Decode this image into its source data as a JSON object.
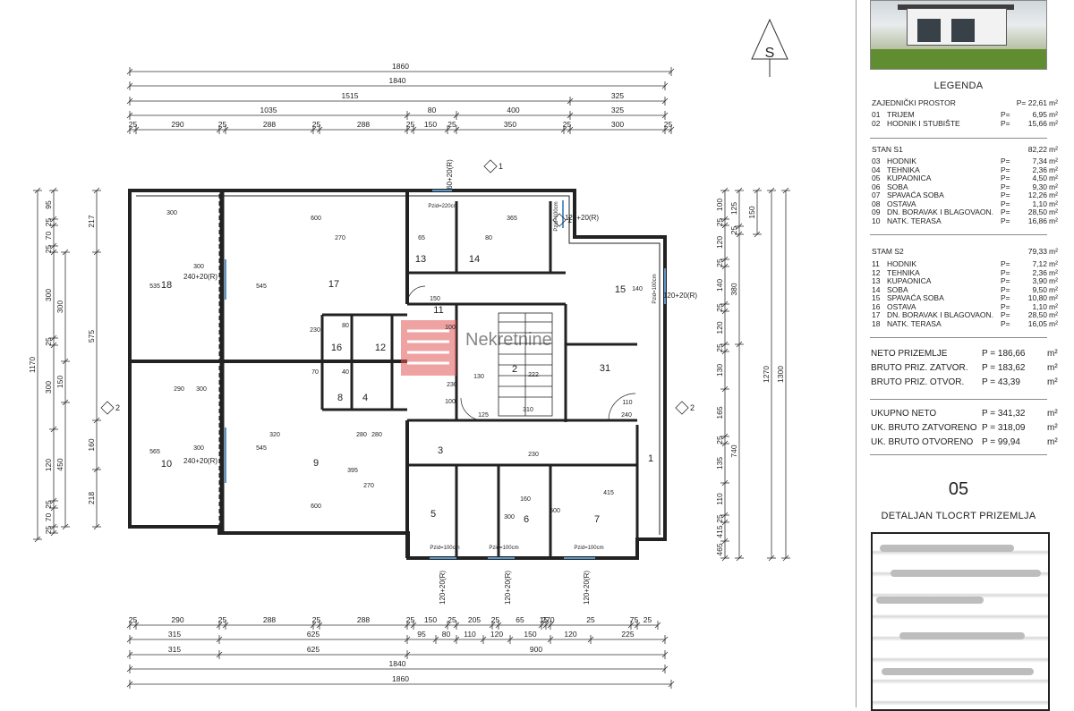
{
  "plan": {
    "north_label": "S",
    "top_dims": {
      "overall": "1860",
      "row2": "1840",
      "row3": [
        "1515",
        "325"
      ],
      "row4": [
        "1035",
        "80",
        "400",
        "325"
      ],
      "row5": [
        "25",
        "290",
        "25",
        "288",
        "25",
        "288",
        "25",
        "150",
        "25",
        "350",
        "25",
        "300",
        "25"
      ]
    },
    "bottom_dims": {
      "row1": [
        "25",
        "290",
        "25",
        "288",
        "25",
        "288",
        "25",
        "150",
        "25",
        "205",
        "25",
        "65",
        "15",
        "270",
        "25",
        "75",
        "25"
      ],
      "row2": [
        "315",
        "625",
        "95",
        "80",
        "110",
        "120",
        "150",
        "120",
        "225"
      ],
      "row3": [
        "315",
        "625",
        "900"
      ],
      "row4": "1840",
      "row5": "1860"
    },
    "left_dims": {
      "outer": "1170",
      "col2": [
        "217",
        "575",
        "160",
        "218"
      ],
      "col3": [
        "300",
        "150",
        "450"
      ],
      "col4": [
        "95",
        "25",
        "70",
        "25",
        "300",
        "25",
        "300",
        "120",
        "25",
        "70",
        "25"
      ]
    },
    "right_dims": {
      "outer": "1300",
      "col2": "1270",
      "col3": [
        "125",
        "25",
        "380",
        "740"
      ],
      "col4": [
        "100",
        "25",
        "120",
        "25",
        "140",
        "25",
        "120",
        "25",
        "130",
        "165",
        "25",
        "135",
        "110",
        "25",
        "415",
        "465"
      ],
      "col5": [
        "150"
      ]
    },
    "rooms": [
      "1",
      "2",
      "3",
      "4",
      "5",
      "6",
      "7",
      "8",
      "9",
      "10",
      "11",
      "12",
      "13",
      "14",
      "15",
      "16",
      "17",
      "18",
      "31"
    ],
    "openings": [
      "240+20(R)",
      "240+20(R)",
      "120+20(R)",
      "120+20(R)",
      "120+20(R)",
      "120+20(R)",
      "120+20(R)",
      "60+20(R)"
    ],
    "doors": [
      "Pzid=220cm",
      "Pzid=100cm",
      "Pzid=100cm",
      "Pzid=100cm",
      "Pzid=100cm",
      "Pzid=100cm"
    ],
    "inner_dims": [
      "300",
      "600",
      "365",
      "535",
      "545",
      "270",
      "300",
      "300",
      "545",
      "270",
      "600",
      "280",
      "320",
      "395",
      "565",
      "300",
      "290",
      "600",
      "150",
      "100",
      "230",
      "125",
      "222",
      "160",
      "415",
      "300",
      "230",
      "140",
      "310",
      "110",
      "240",
      "100",
      "130",
      "65",
      "80",
      "230",
      "70",
      "80",
      "40",
      "280"
    ],
    "section_marks": [
      "1",
      "1",
      "2",
      "2"
    ],
    "watermark": "Nekretnine"
  },
  "legend": {
    "title": "LEGENDA",
    "common": {
      "name": "ZAJEDNIČKI PROSTOR",
      "value": "P= 22,61",
      "unit": "m²"
    },
    "common_rows": [
      {
        "num": "01",
        "name": "TRIJEM",
        "value": "6,95"
      },
      {
        "num": "02",
        "name": "HODNIK I STUBIŠTE",
        "value": "15,66"
      }
    ],
    "s1": {
      "name": "STAN S1",
      "value": "82,22",
      "unit": "m²"
    },
    "s1_rows": [
      {
        "num": "03",
        "name": "HODNIK",
        "value": "7,34"
      },
      {
        "num": "04",
        "name": "TEHNIKA",
        "value": "2,36"
      },
      {
        "num": "05",
        "name": "KUPAONICA",
        "value": "4,50"
      },
      {
        "num": "06",
        "name": "SOBA",
        "value": "9,30"
      },
      {
        "num": "07",
        "name": "SPAVAĆA SOBA",
        "value": "12,26"
      },
      {
        "num": "08",
        "name": "OSTAVA",
        "value": "1,10"
      },
      {
        "num": "09",
        "name": "DN. BORAVAK I BLAGOVAON.",
        "value": "28,50"
      },
      {
        "num": "10",
        "name": "NATK. TERASA",
        "value": "16,86"
      }
    ],
    "s2": {
      "name": "STAM S2",
      "value": "79,33",
      "unit": "m²"
    },
    "s2_rows": [
      {
        "num": "11",
        "name": "HODNIK",
        "value": "7,12"
      },
      {
        "num": "12",
        "name": "TEHNIKA",
        "value": "2,36"
      },
      {
        "num": "13",
        "name": "KUPAONICA",
        "value": "3,90"
      },
      {
        "num": "14",
        "name": "SOBA",
        "value": "9,50"
      },
      {
        "num": "15",
        "name": "SPAVAĆA SOBA",
        "value": "10,80"
      },
      {
        "num": "16",
        "name": "OSTAVA",
        "value": "1,10"
      },
      {
        "num": "17",
        "name": "DN. BORAVAK I BLAGOVAON.",
        "value": "28,50"
      },
      {
        "num": "18",
        "name": "NATK. TERASA",
        "value": "16,05"
      }
    ],
    "p_label": "P=",
    "unit": "m²",
    "totals1": [
      {
        "name": "NETO PRIZEMLJE",
        "value": "P = 186,66"
      },
      {
        "name": "BRUTO PRIZ. ZATVOR.",
        "value": "P = 183,62"
      },
      {
        "name": "BRUTO PRIZ. OTVOR.",
        "value": "P =   43,39"
      }
    ],
    "totals2": [
      {
        "name": "UKUPNO NETO",
        "value": "P = 341,32"
      },
      {
        "name": "UK. BRUTO ZATVORENO",
        "value": "P = 318,09"
      },
      {
        "name": "UK. BRUTO OTVORENO",
        "value": "P =   99,94"
      }
    ],
    "sheet_number": "05",
    "sheet_title": "DETALJAN TLOCRT PRIZEMLJA"
  }
}
